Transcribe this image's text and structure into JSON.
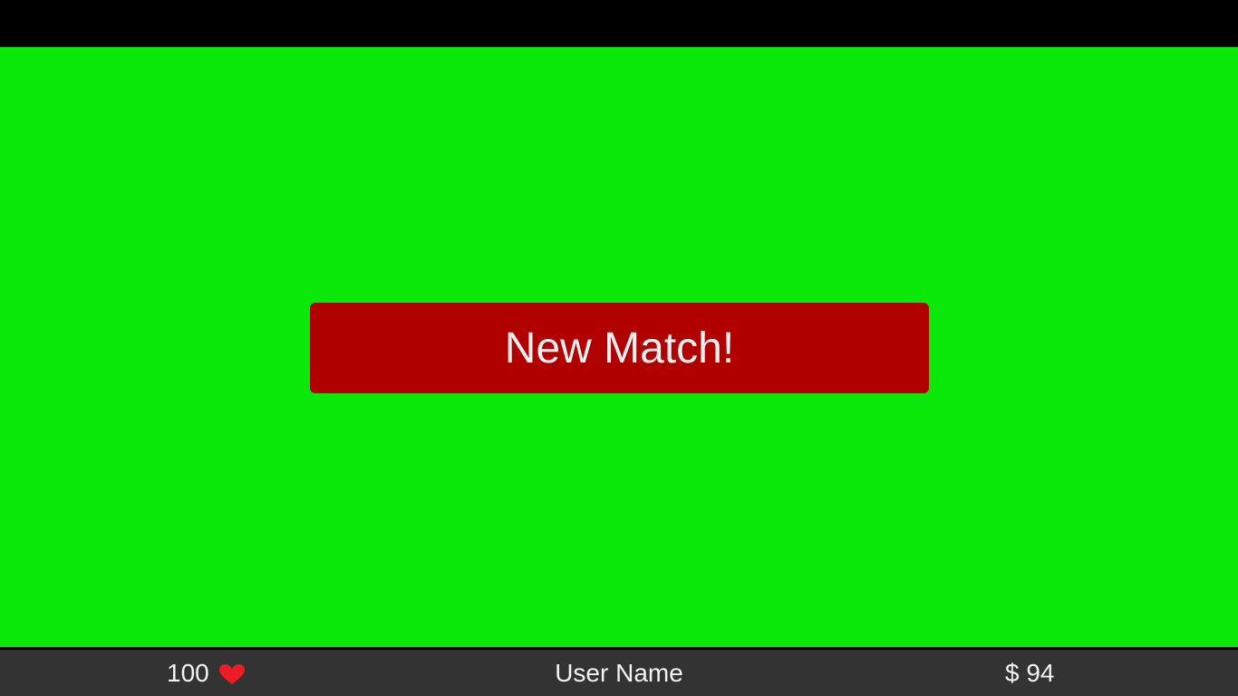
{
  "game": {
    "new_match_label": "New Match!"
  },
  "status": {
    "health": "100",
    "username": "User Name",
    "money": "$ 94"
  },
  "colors": {
    "background": "#0ae90a",
    "button": "#b00000",
    "heart": "#ee1c25",
    "status_bar": "#333333"
  },
  "icons": {
    "health": "heart-icon"
  }
}
